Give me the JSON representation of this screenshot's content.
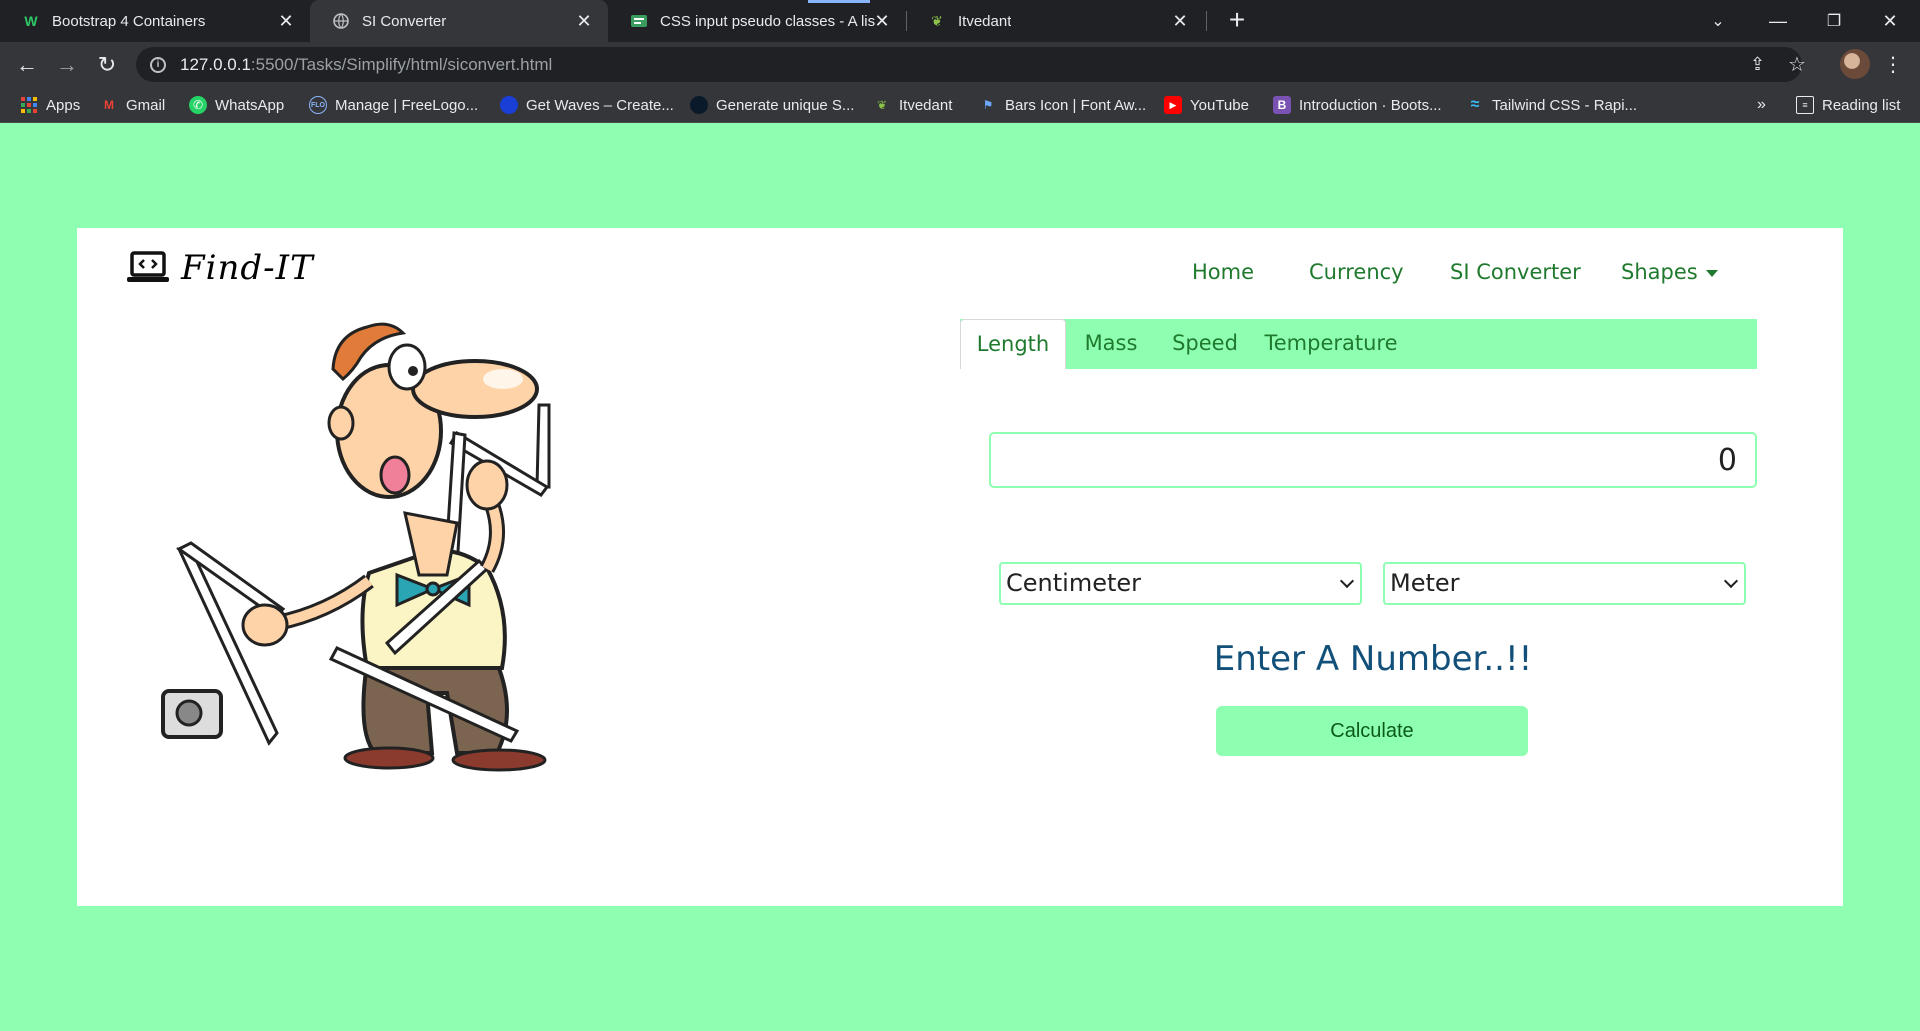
{
  "browser": {
    "tabs": [
      {
        "label": "Bootstrap 4 Containers",
        "favicon": "W"
      },
      {
        "label": "SI Converter",
        "favicon": "globe"
      },
      {
        "label": "CSS input pseudo classes - A list",
        "favicon": "css"
      },
      {
        "label": "Itvedant",
        "favicon": "butterfly"
      }
    ],
    "url_host": "127.0.0.1",
    "url_path": ":5500/Tasks/Simplify/html/siconvert.html",
    "bookmarks": [
      {
        "label": "Apps"
      },
      {
        "label": "Gmail"
      },
      {
        "label": "WhatsApp"
      },
      {
        "label": "Manage | FreeLogo..."
      },
      {
        "label": "Get Waves – Create..."
      },
      {
        "label": "Generate unique S..."
      },
      {
        "label": "Itvedant"
      },
      {
        "label": "Bars Icon | Font Aw..."
      },
      {
        "label": "YouTube"
      },
      {
        "label": "Introduction · Boots..."
      },
      {
        "label": "Tailwind CSS - Rapi..."
      }
    ],
    "more_bookmarks": "»",
    "reading_list": "Reading list"
  },
  "page": {
    "brand": "Find-IT",
    "nav": {
      "home": "Home",
      "currency": "Currency",
      "si_converter": "SI Converter",
      "shapes": "Shapes"
    },
    "unit_tabs": [
      "Length",
      "Mass",
      "Speed",
      "Temperature"
    ],
    "active_unit_tab": "Length",
    "number_input_value": "0",
    "from_unit": "Centimeter",
    "to_unit": "Meter",
    "result_text": "Enter A Number..!!",
    "calculate_label": "Calculate"
  },
  "colors": {
    "accent": "#8effb0",
    "nav_text": "#1f7a2e",
    "result_text": "#12507a"
  }
}
